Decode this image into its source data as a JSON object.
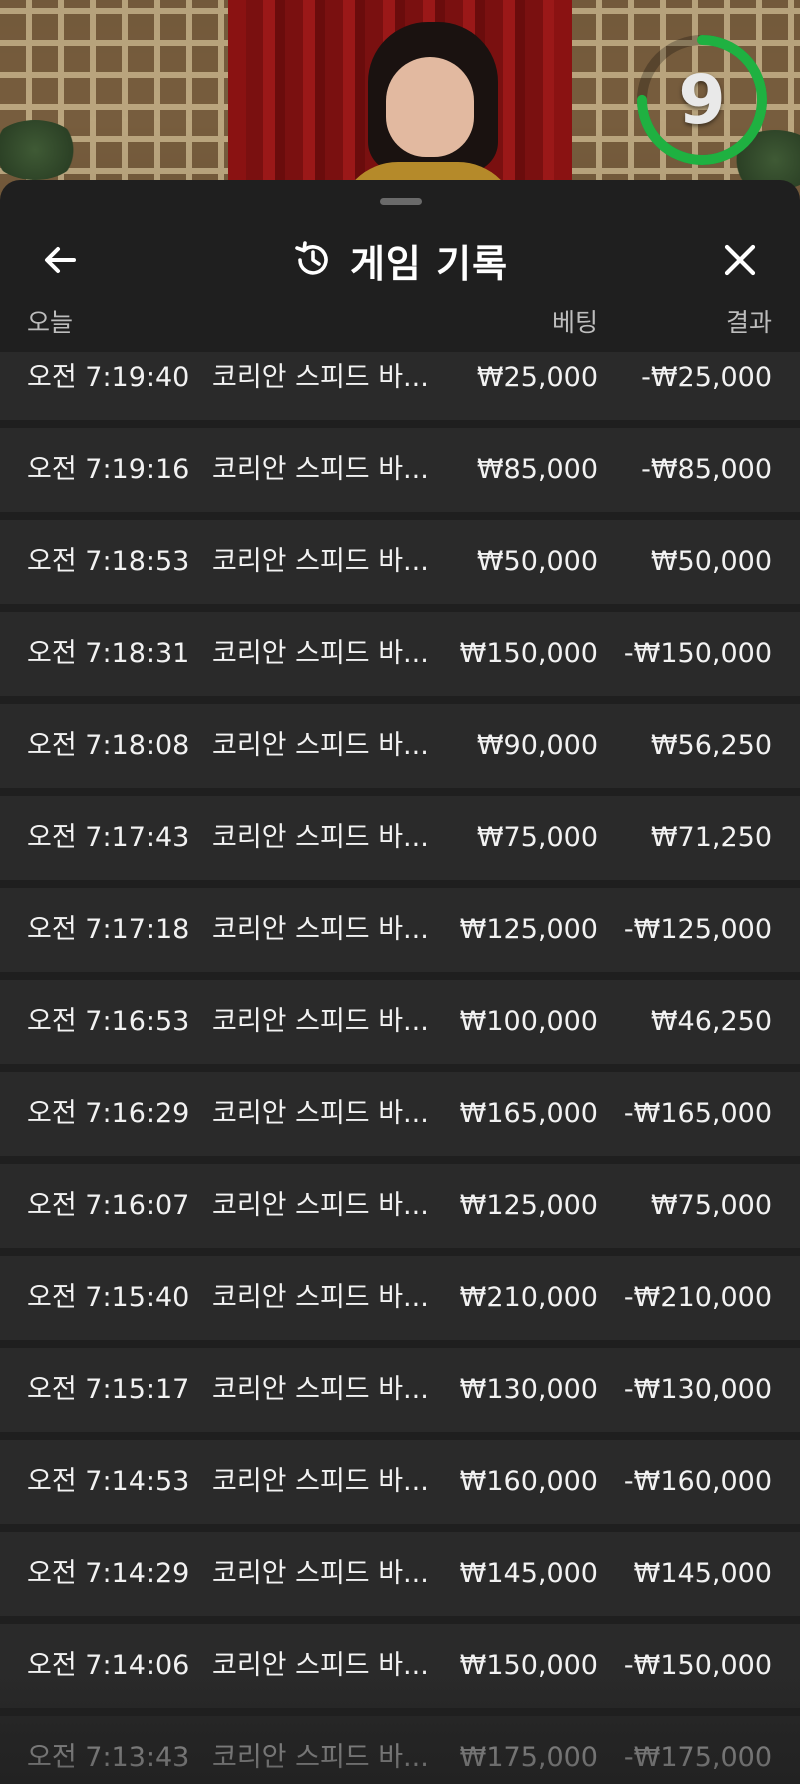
{
  "live": {
    "countdown": "9",
    "countdown_progress": 0.75,
    "timer_color": "#1fb141"
  },
  "sheet": {
    "title": "게임 기록",
    "icons": {
      "back": "arrow-left-icon",
      "history": "history-icon",
      "close": "close-icon"
    }
  },
  "columns": {
    "date": "오늘",
    "bet": "베팅",
    "result": "결과"
  },
  "rows": [
    {
      "time": "오전 7:19:40",
      "game": "코리안 스피드 바...",
      "bet": "₩25,000",
      "result": "-₩25,000"
    },
    {
      "time": "오전 7:19:16",
      "game": "코리안 스피드 바...",
      "bet": "₩85,000",
      "result": "-₩85,000"
    },
    {
      "time": "오전 7:18:53",
      "game": "코리안 스피드 바...",
      "bet": "₩50,000",
      "result": "₩50,000"
    },
    {
      "time": "오전 7:18:31",
      "game": "코리안 스피드 바...",
      "bet": "₩150,000",
      "result": "-₩150,000"
    },
    {
      "time": "오전 7:18:08",
      "game": "코리안 스피드 바...",
      "bet": "₩90,000",
      "result": "₩56,250"
    },
    {
      "time": "오전 7:17:43",
      "game": "코리안 스피드 바...",
      "bet": "₩75,000",
      "result": "₩71,250"
    },
    {
      "time": "오전 7:17:18",
      "game": "코리안 스피드 바...",
      "bet": "₩125,000",
      "result": "-₩125,000"
    },
    {
      "time": "오전 7:16:53",
      "game": "코리안 스피드 바...",
      "bet": "₩100,000",
      "result": "₩46,250"
    },
    {
      "time": "오전 7:16:29",
      "game": "코리안 스피드 바...",
      "bet": "₩165,000",
      "result": "-₩165,000"
    },
    {
      "time": "오전 7:16:07",
      "game": "코리안 스피드 바...",
      "bet": "₩125,000",
      "result": "₩75,000"
    },
    {
      "time": "오전 7:15:40",
      "game": "코리안 스피드 바...",
      "bet": "₩210,000",
      "result": "-₩210,000"
    },
    {
      "time": "오전 7:15:17",
      "game": "코리안 스피드 바...",
      "bet": "₩130,000",
      "result": "-₩130,000"
    },
    {
      "time": "오전 7:14:53",
      "game": "코리안 스피드 바...",
      "bet": "₩160,000",
      "result": "-₩160,000"
    },
    {
      "time": "오전 7:14:29",
      "game": "코리안 스피드 바...",
      "bet": "₩145,000",
      "result": "₩145,000"
    },
    {
      "time": "오전 7:14:06",
      "game": "코리안 스피드 바...",
      "bet": "₩150,000",
      "result": "-₩150,000"
    },
    {
      "time": "오전 7:13:43",
      "game": "코리안 스피드 바...",
      "bet": "₩175,000",
      "result": "-₩175,000"
    }
  ]
}
